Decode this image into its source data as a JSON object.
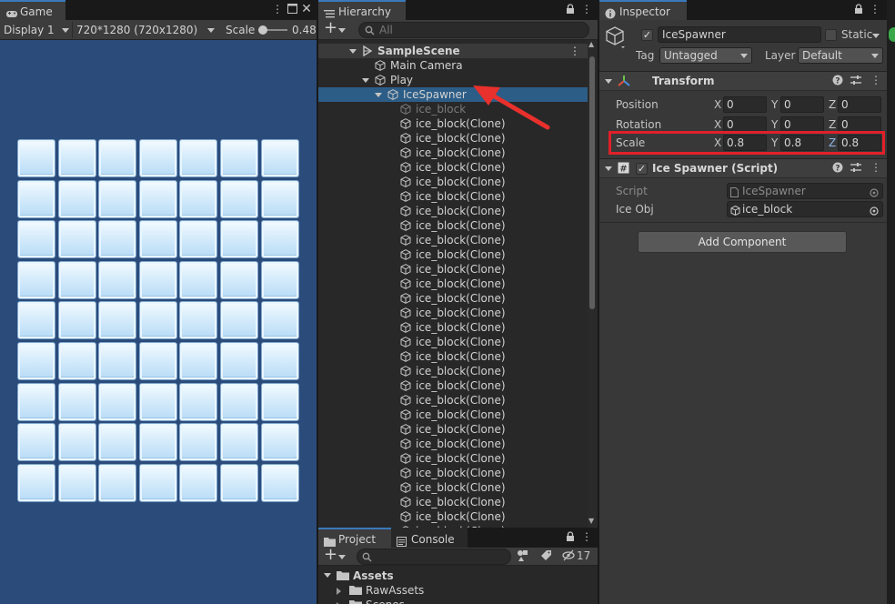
{
  "game": {
    "tab": "Game",
    "display": "Display 1",
    "resolution": "720*1280 (720x1280)",
    "scale_label": "Scale",
    "scale_value": "0.48",
    "grid": {
      "rows": 9,
      "cols": 7
    }
  },
  "hierarchy": {
    "tab": "Hierarchy",
    "search_placeholder": "All",
    "add_label": "+",
    "rows": [
      {
        "label": "SampleScene",
        "depth": 0,
        "type": "scene",
        "expanded": true
      },
      {
        "label": "Main Camera",
        "depth": 1,
        "type": "object"
      },
      {
        "label": "Play",
        "depth": 1,
        "type": "object",
        "expanded": true
      },
      {
        "label": "IceSpawner",
        "depth": 2,
        "type": "object",
        "expanded": true,
        "selected": true
      },
      {
        "label": "ice_block",
        "depth": 3,
        "type": "object",
        "disabled": true
      },
      {
        "label": "ice_block(Clone)",
        "depth": 3,
        "type": "object"
      },
      {
        "label": "ice_block(Clone)",
        "depth": 3,
        "type": "object"
      },
      {
        "label": "ice_block(Clone)",
        "depth": 3,
        "type": "object"
      },
      {
        "label": "ice_block(Clone)",
        "depth": 3,
        "type": "object"
      },
      {
        "label": "ice_block(Clone)",
        "depth": 3,
        "type": "object"
      },
      {
        "label": "ice_block(Clone)",
        "depth": 3,
        "type": "object"
      },
      {
        "label": "ice_block(Clone)",
        "depth": 3,
        "type": "object"
      },
      {
        "label": "ice_block(Clone)",
        "depth": 3,
        "type": "object"
      },
      {
        "label": "ice_block(Clone)",
        "depth": 3,
        "type": "object"
      },
      {
        "label": "ice_block(Clone)",
        "depth": 3,
        "type": "object"
      },
      {
        "label": "ice_block(Clone)",
        "depth": 3,
        "type": "object"
      },
      {
        "label": "ice_block(Clone)",
        "depth": 3,
        "type": "object"
      },
      {
        "label": "ice_block(Clone)",
        "depth": 3,
        "type": "object"
      },
      {
        "label": "ice_block(Clone)",
        "depth": 3,
        "type": "object"
      },
      {
        "label": "ice_block(Clone)",
        "depth": 3,
        "type": "object"
      },
      {
        "label": "ice_block(Clone)",
        "depth": 3,
        "type": "object"
      },
      {
        "label": "ice_block(Clone)",
        "depth": 3,
        "type": "object"
      },
      {
        "label": "ice_block(Clone)",
        "depth": 3,
        "type": "object"
      },
      {
        "label": "ice_block(Clone)",
        "depth": 3,
        "type": "object"
      },
      {
        "label": "ice_block(Clone)",
        "depth": 3,
        "type": "object"
      },
      {
        "label": "ice_block(Clone)",
        "depth": 3,
        "type": "object"
      },
      {
        "label": "ice_block(Clone)",
        "depth": 3,
        "type": "object"
      },
      {
        "label": "ice_block(Clone)",
        "depth": 3,
        "type": "object"
      },
      {
        "label": "ice_block(Clone)",
        "depth": 3,
        "type": "object"
      },
      {
        "label": "ice_block(Clone)",
        "depth": 3,
        "type": "object"
      },
      {
        "label": "ice_block(Clone)",
        "depth": 3,
        "type": "object"
      },
      {
        "label": "ice_block(Clone)",
        "depth": 3,
        "type": "object"
      },
      {
        "label": "ice_block(Clone)",
        "depth": 3,
        "type": "object"
      },
      {
        "label": "ice_block(Clone)",
        "depth": 3,
        "type": "object"
      }
    ]
  },
  "project": {
    "tab_project": "Project",
    "tab_console": "Console",
    "hidden_count": "17",
    "tree": [
      {
        "label": "Assets",
        "depth": 0,
        "expanded": true
      },
      {
        "label": "RawAssets",
        "depth": 1
      },
      {
        "label": "Scenes",
        "depth": 1
      }
    ]
  },
  "inspector": {
    "tab": "Inspector",
    "object_name": "IceSpawner",
    "static_label": "Static",
    "tag_label": "Tag",
    "tag_value": "Untagged",
    "layer_label": "Layer",
    "layer_value": "Default",
    "transform": {
      "title": "Transform",
      "position": {
        "label": "Position",
        "x": "0",
        "y": "0",
        "z": "0"
      },
      "rotation": {
        "label": "Rotation",
        "x": "0",
        "y": "0",
        "z": "0"
      },
      "scale": {
        "label": "Scale",
        "x": "0.8",
        "y": "0.8",
        "z": "0.8"
      }
    },
    "script_component": {
      "title": "Ice Spawner (Script)",
      "script_label": "Script",
      "script_value": "IceSpawner",
      "iceobj_label": "Ice Obj",
      "iceobj_value": "ice_block"
    },
    "add_component": "Add Component"
  },
  "colors": {
    "highlight_box": "#e0202a",
    "annotation_arrow": "#e8302c",
    "selection": "#2c5d87",
    "accent_tab": "#3a79bb"
  }
}
